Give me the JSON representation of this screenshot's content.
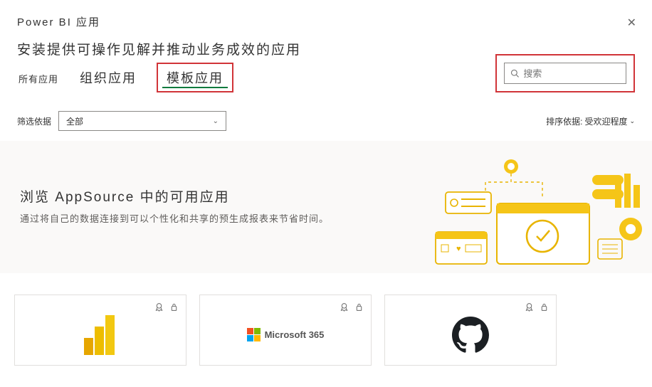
{
  "header": {
    "title": "Power BI 应用",
    "close": "✕"
  },
  "subtitle": "安装提供可操作见解并推动业务成效的应用",
  "tabs": {
    "all": "所有应用",
    "org": "组织应用",
    "template": "模板应用"
  },
  "search": {
    "placeholder": "搜索"
  },
  "filter": {
    "label": "筛选依据",
    "value": "全部"
  },
  "sort": {
    "prefix": "排序依据:",
    "value": "受欢迎程度"
  },
  "banner": {
    "heading": "浏览 AppSource 中的可用应用",
    "desc": "通过将自己的数据连接到可以个性化和共享的预生成报表来节省时间。"
  },
  "cards": {
    "microsoft365": "Microsoft 365"
  }
}
